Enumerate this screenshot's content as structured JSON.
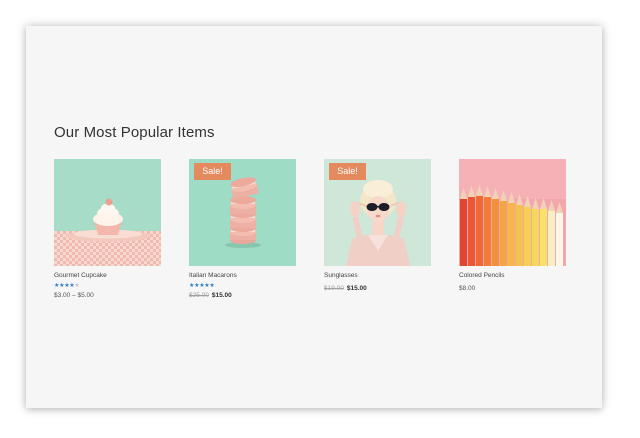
{
  "section": {
    "title": "Our Most Popular Items"
  },
  "products": [
    {
      "name": "Gourmet Cupcake",
      "rating": 4,
      "rating_max": 5,
      "price": "$3.00 – $5.00",
      "image": "cupcake-photo"
    },
    {
      "name": "Italian Macarons",
      "rating": 5,
      "rating_max": 5,
      "badge": "Sale!",
      "price_old": "$25.00",
      "price_new": "$15.00",
      "image": "macarons-photo"
    },
    {
      "name": "Sunglasses",
      "badge": "Sale!",
      "price_old": "$19.00",
      "price_new": "$15.00",
      "image": "sunglasses-photo"
    },
    {
      "name": "Colored Pencils",
      "price": "$8.00",
      "image": "pencils-photo"
    }
  ],
  "colors": {
    "sale_badge": "#e58a5f",
    "star": "#2b7fc6",
    "mint_background": "#a7ddc9"
  }
}
